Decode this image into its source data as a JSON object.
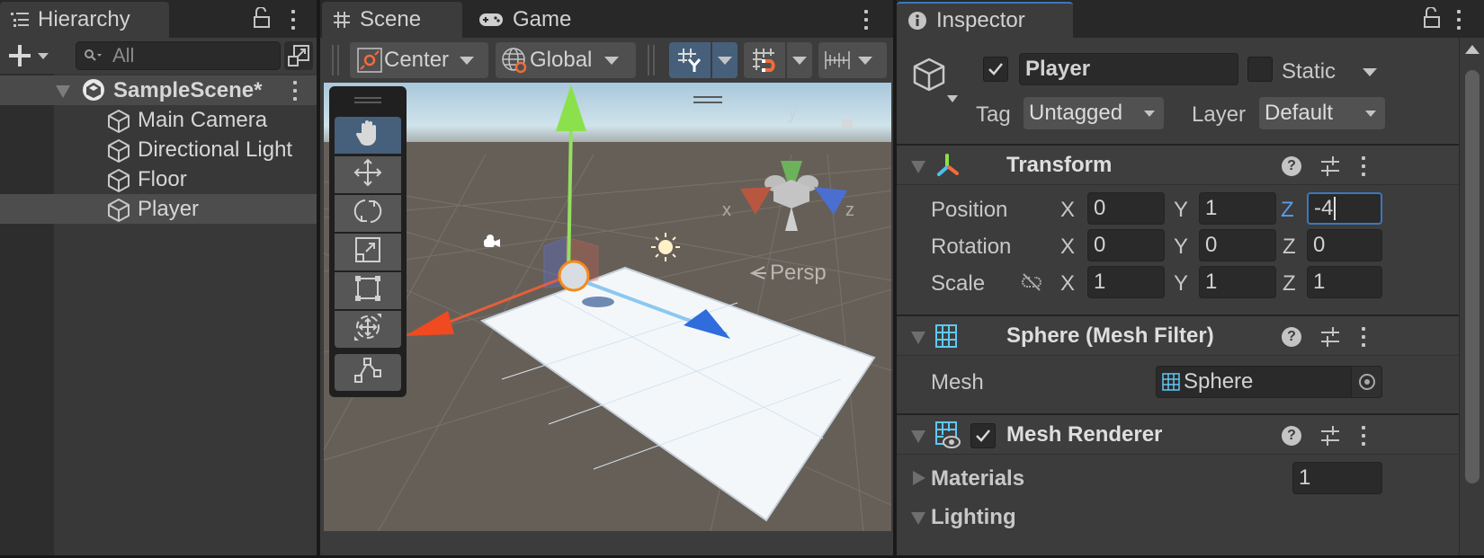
{
  "hierarchy": {
    "tab_label": "Hierarchy",
    "search_placeholder": "All",
    "scene_name": "SampleScene*",
    "items": [
      {
        "label": "Main Camera"
      },
      {
        "label": "Directional Light"
      },
      {
        "label": "Floor"
      },
      {
        "label": "Player",
        "selected": true
      }
    ]
  },
  "scene": {
    "tabs": [
      {
        "label": "Scene",
        "icon": "grid-icon",
        "active": true
      },
      {
        "label": "Game",
        "icon": "gamepad-icon",
        "active": false
      }
    ],
    "toolbar": {
      "pivot_mode": "Center",
      "pivot_rotation": "Global"
    },
    "tools": [
      "hand",
      "move",
      "rotate",
      "scale",
      "rect",
      "transform",
      "custom-editor"
    ],
    "active_tool": "hand",
    "gizmo_axes": {
      "x": "x",
      "y": "y",
      "z": "z"
    },
    "projection_label": "Persp"
  },
  "inspector": {
    "tab_label": "Inspector",
    "object": {
      "active": true,
      "name": "Player",
      "static_label": "Static",
      "static": false,
      "tag_label": "Tag",
      "tag": "Untagged",
      "layer_label": "Layer",
      "layer": "Default"
    },
    "transform": {
      "title": "Transform",
      "rows": [
        {
          "label": "Position",
          "x": "0",
          "y": "1",
          "z": "-4"
        },
        {
          "label": "Rotation",
          "x": "0",
          "y": "0",
          "z": "0"
        },
        {
          "label": "Scale",
          "x": "1",
          "y": "1",
          "z": "1"
        }
      ],
      "axis_labels": {
        "x": "X",
        "y": "Y",
        "z": "Z"
      }
    },
    "mesh_filter": {
      "title": "Sphere (Mesh Filter)",
      "mesh_label": "Mesh",
      "mesh_value": "Sphere"
    },
    "mesh_renderer": {
      "title": "Mesh Renderer",
      "enabled": true,
      "materials_label": "Materials",
      "materials_count": "1",
      "lighting_label": "Lighting"
    },
    "colors": {
      "accent": "#3a79bb",
      "icon_blue": "#5fc8f5"
    }
  }
}
